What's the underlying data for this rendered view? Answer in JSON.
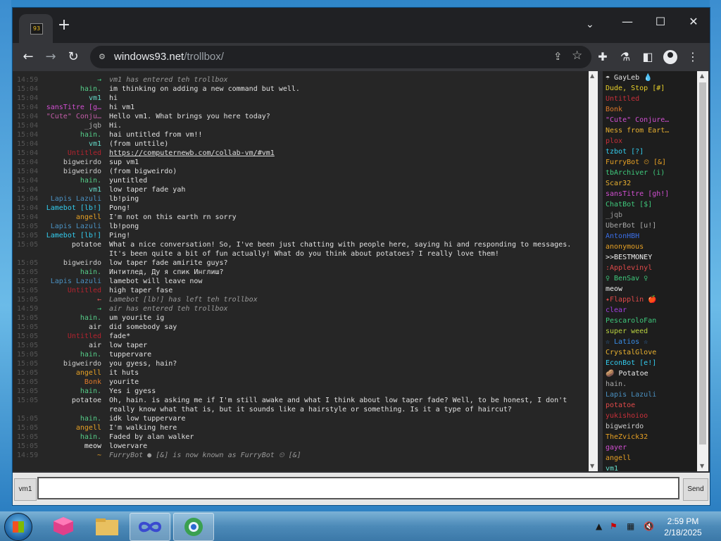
{
  "browser": {
    "new_tab": "+",
    "chevron": "⌄",
    "window_controls": {
      "minimize": "—",
      "maximize": "☐",
      "close": "✕"
    },
    "back": "←",
    "forward": "→",
    "reload": "↻",
    "url_host": "windows93.net",
    "url_path": "/trollbox/"
  },
  "chat": {
    "messages": [
      {
        "time": "14:59",
        "nick": "→",
        "nick_color": "#3fc97c",
        "text": "vm1 has entered teh trollbox",
        "sys": true
      },
      {
        "time": "15:04",
        "nick": "hain.",
        "nick_color": "#55cc88",
        "text": "im thinking on adding a new command but well."
      },
      {
        "time": "15:04",
        "nick": "vm1",
        "nick_color": "#66ddcc",
        "text": "hi"
      },
      {
        "time": "15:04",
        "nick": "sansTitre [g…",
        "nick_color": "#d14fd1",
        "text": "hi vm1"
      },
      {
        "time": "15:04",
        "nick": "\"Cute\" Conju…",
        "nick_color": "#c35da8",
        "text": "Hello vm1. What brings you here today?"
      },
      {
        "time": "15:04",
        "nick": "_jqb",
        "nick_color": "#aaaaaa",
        "text": "Hi."
      },
      {
        "time": "15:04",
        "nick": "hain.",
        "nick_color": "#55cc88",
        "text": "hai untitled from vm!!"
      },
      {
        "time": "15:04",
        "nick": "vm1",
        "nick_color": "#66ddcc",
        "text": "(from unttile)"
      },
      {
        "time": "15:04",
        "nick": "Untitled",
        "nick_color": "#b3232f",
        "text": "https://computernewb.com/collab-vm/#vm1",
        "link": true
      },
      {
        "time": "15:04",
        "nick": "bigweirdo",
        "nick_color": "#cccccc",
        "text": "sup vm1"
      },
      {
        "time": "15:04",
        "nick": "bigweirdo",
        "nick_color": "#cccccc",
        "text": "(from bigweirdo)"
      },
      {
        "time": "15:04",
        "nick": "hain.",
        "nick_color": "#55cc88",
        "text": "yuntitled"
      },
      {
        "time": "15:04",
        "nick": "vm1",
        "nick_color": "#66ddcc",
        "text": "low taper fade yah"
      },
      {
        "time": "15:04",
        "nick": "Lapis Lazuli",
        "nick_color": "#4a90c0",
        "text": "lb!ping"
      },
      {
        "time": "15:04",
        "nick": "Lamebot [lb!]",
        "nick_color": "#33ccee",
        "text": "Pong!"
      },
      {
        "time": "15:04",
        "nick": "angell",
        "nick_color": "#e6a024",
        "text": " I'm not on this earth rn  sorry"
      },
      {
        "time": "15:05",
        "nick": "Lapis Lazuli",
        "nick_color": "#4a90c0",
        "text": "lb!pong"
      },
      {
        "time": "15:05",
        "nick": "Lamebot [lb!]",
        "nick_color": "#33ccee",
        "text": "Ping!"
      },
      {
        "time": "15:05",
        "nick": "potatoe",
        "nick_color": "#dddddd",
        "text": "What a nice conversation! So, I've been just chatting with people here, saying hi and responding to messages."
      },
      {
        "time": "",
        "nick": "",
        "nick_color": "#dddddd",
        "text": "It's been quite a bit of fun actually! What do you think about potatoes? I really love them!"
      },
      {
        "time": "15:05",
        "nick": "bigweirdo",
        "nick_color": "#cccccc",
        "text": "low taper fade amirite guys?"
      },
      {
        "time": "15:05",
        "nick": "hain.",
        "nick_color": "#55cc88",
        "text": "Интитлед, Ду я спик Инглиш?"
      },
      {
        "time": "15:05",
        "nick": "Lapis Lazuli",
        "nick_color": "#4a90c0",
        "text": "lamebot will leave now"
      },
      {
        "time": "15:05",
        "nick": "Untitled",
        "nick_color": "#b3232f",
        "text": "high taper fase"
      },
      {
        "time": "15:05",
        "nick": "←",
        "nick_color": "#e05050",
        "text": "Lamebot [lb!] has left teh trollbox",
        "sys": true
      },
      {
        "time": "14:59",
        "nick": "→",
        "nick_color": "#3fc97c",
        "text": "air has entered teh trollbox",
        "sys": true
      },
      {
        "time": "15:05",
        "nick": "hain.",
        "nick_color": "#55cc88",
        "text": "um yourite ig"
      },
      {
        "time": "15:05",
        "nick": "air",
        "nick_color": "#dddddd",
        "text": "did somebody say"
      },
      {
        "time": "15:05",
        "nick": "Untitled",
        "nick_color": "#b3232f",
        "text": "fade*"
      },
      {
        "time": "15:05",
        "nick": "air",
        "nick_color": "#dddddd",
        "text": "low taper"
      },
      {
        "time": "15:05",
        "nick": "hain.",
        "nick_color": "#55cc88",
        "text": "tuppervare"
      },
      {
        "time": "15:05",
        "nick": "bigweirdo",
        "nick_color": "#cccccc",
        "text": "you gyess, hain?"
      },
      {
        "time": "15:05",
        "nick": "angell",
        "nick_color": "#e6a024",
        "text": "it huts"
      },
      {
        "time": "15:05",
        "nick": "Bonk",
        "nick_color": "#e07a2a",
        "text": "yourite"
      },
      {
        "time": "15:05",
        "nick": "hain.",
        "nick_color": "#55cc88",
        "text": "Yes i gyess"
      },
      {
        "time": "15:05",
        "nick": "potatoe",
        "nick_color": "#dddddd",
        "text": "Oh, hain. is asking me if I'm still awake and what I think about low taper fade? Well, to be honest, I don't"
      },
      {
        "time": "",
        "nick": "",
        "nick_color": "#dddddd",
        "text": "really know what that is, but it sounds like a hairstyle or something. Is it a type of haircut?"
      },
      {
        "time": "15:05",
        "nick": "hain.",
        "nick_color": "#55cc88",
        "text": "idk low tuppervare"
      },
      {
        "time": "15:05",
        "nick": "angell",
        "nick_color": "#e6a024",
        "text": "I'm walking here"
      },
      {
        "time": "15:05",
        "nick": "hain.",
        "nick_color": "#55cc88",
        "text": "Faded by alan walker"
      },
      {
        "time": "15:05",
        "nick": "meow",
        "nick_color": "#eeeeee",
        "text": "lowervare"
      },
      {
        "time": "14:59",
        "nick": "~",
        "nick_color": "#e6a024",
        "text": "FurryBot ● [&] is now known as FurryBot ⏲ [&]",
        "sys": true
      }
    ]
  },
  "users": [
    {
      "name": "☂ GayLeb 💧",
      "color": "#e0e0e0"
    },
    {
      "name": "Dude, Stop [#]",
      "color": "#e8d02a"
    },
    {
      "name": "Untitled",
      "color": "#c8303a"
    },
    {
      "name": "Bonk",
      "color": "#e07a2a"
    },
    {
      "name": "\"Cute\" Conjure…",
      "color": "#d14fd1"
    },
    {
      "name": "Ness from Eart…",
      "color": "#e8b030"
    },
    {
      "name": "plox",
      "color": "#c8303a"
    },
    {
      "name": "tzbot [?]",
      "color": "#33ccee"
    },
    {
      "name": "FurryBot ⏲ [&]",
      "color": "#e6a024"
    },
    {
      "name": "tbArchiver (i)",
      "color": "#3fc97c"
    },
    {
      "name": "Scar32",
      "color": "#e8b030"
    },
    {
      "name": "sansTitre [gh!]",
      "color": "#d14fd1"
    },
    {
      "name": "ChatBot [$]",
      "color": "#3fc97c"
    },
    {
      "name": "_jqb",
      "color": "#999999"
    },
    {
      "name": "UberBot [u!]",
      "color": "#aaaaaa"
    },
    {
      "name": "AntonHBH",
      "color": "#3a6ee8"
    },
    {
      "name": "anonymous",
      "color": "#e6a024"
    },
    {
      "name": ">>BESTMONEY",
      "color": "#eeeeee"
    },
    {
      "name": ":Applevinyl",
      "color": "#e04a4a"
    },
    {
      "name": "♀ BenSav ♀",
      "color": "#3fc97c"
    },
    {
      "name": "meow",
      "color": "#eeeeee"
    },
    {
      "name": "✦Flapplin 🍎",
      "color": "#e04a4a"
    },
    {
      "name": "clear",
      "color": "#a040e0"
    },
    {
      "name": "PescaroloFan",
      "color": "#3fc97c"
    },
    {
      "name": "super weed",
      "color": "#b8d040"
    },
    {
      "name": "☆ Latios ☆",
      "color": "#3a8ee8"
    },
    {
      "name": "CrystalGlove",
      "color": "#e8b030"
    },
    {
      "name": "EconBot [e!]",
      "color": "#33ccee"
    },
    {
      "name": "🥔 Potatoe",
      "color": "#eeeeee"
    },
    {
      "name": "hain.",
      "color": "#aaaaaa"
    },
    {
      "name": "Lapis Lazuli",
      "color": "#4a90c0"
    },
    {
      "name": "potatoe",
      "color": "#e04a4a"
    },
    {
      "name": "yukishoioo",
      "color": "#c8303a"
    },
    {
      "name": "bigweirdo",
      "color": "#cccccc"
    },
    {
      "name": "TheZvick32",
      "color": "#e6a024"
    },
    {
      "name": "gayer",
      "color": "#d14fd1"
    },
    {
      "name": "angell",
      "color": "#e6a024"
    },
    {
      "name": "vm1",
      "color": "#66ddcc"
    }
  ],
  "input": {
    "nick": "vm1",
    "placeholder": "",
    "send": "Send"
  },
  "taskbar": {
    "time": "2:59 PM",
    "date": "2/18/2025"
  }
}
